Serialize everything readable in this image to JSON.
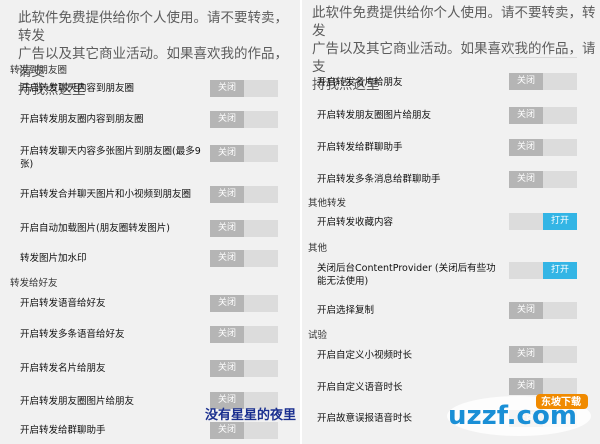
{
  "notice": {
    "left": [
      "此软件免费提供给你个人使用。请不要转卖，转发",
      "广告以及其它商业活动。如果喜欢我的作品，请支",
      "持我点这里"
    ],
    "right": [
      "此软件免费提供给你个人使用。请不要转卖，转发",
      "广告以及其它商业活动。如果喜欢我的作品，请支",
      "持我点这里"
    ]
  },
  "toggle_off": "关闭",
  "toggle_on": "打开",
  "left": {
    "section_moments": "转发到朋友圈",
    "section_friends": "转发给好友",
    "items": [
      "开启转发聊天内容到朋友圈",
      "开启转发朋友圈内容到朋友圈",
      "开启转发聊天内容多张图片到朋友圈(最多9张)",
      "开启转发合并聊天图片和小视频到朋友圈",
      "开启自动加载图片(朋友圈转发图片)",
      "转发图片加水印",
      "开启转发语音给好友",
      "开启转发多条语音给好友",
      "开启转发名片给朋友",
      "开启转发朋友圈图片给朋友",
      "开启转发给群聊助手"
    ]
  },
  "right": {
    "section_other_forward": "其他转发",
    "section_other": "其他",
    "section_test": "试验",
    "items": [
      "开启转发名片给朋友",
      "开启转发朋友圈图片给朋友",
      "开启转发给群聊助手",
      "开启转发多条消息给群聊助手",
      "开启转发收藏内容",
      "关闭后台ContentProvider (关闭后有些功能无法使用)",
      "开启选择复制",
      "开启自定义小视频时长",
      "开启自定义语音时长",
      "开启故意误报语音时长"
    ],
    "states": [
      "off",
      "off",
      "off",
      "off",
      "on",
      "on",
      "off",
      "off",
      "off",
      "off"
    ]
  },
  "watermark_text": "没有星星的夜里",
  "logo": {
    "main": "uzzf.com",
    "sub": "东坡下载"
  }
}
